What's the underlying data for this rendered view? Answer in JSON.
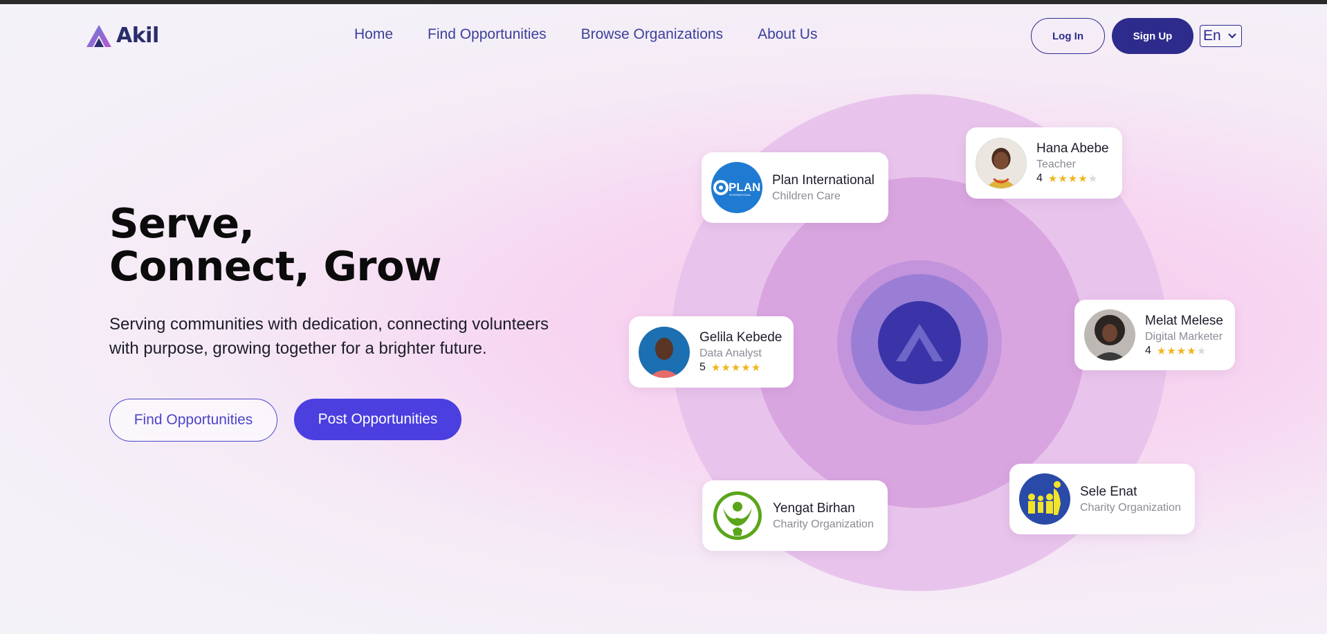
{
  "brand": {
    "name": "Akil",
    "accent": "#2d2b8c",
    "primary_button": "#4b3fe0"
  },
  "nav": {
    "items": [
      {
        "label": "Home"
      },
      {
        "label": "Find Opportunities"
      },
      {
        "label": "Browse Organizations"
      },
      {
        "label": "About Us"
      }
    ]
  },
  "auth": {
    "login_label": "Log In",
    "signup_label": "Sign Up"
  },
  "language": {
    "selected": "En"
  },
  "hero": {
    "title_line1": "Serve,",
    "title_line2": "Connect, Grow",
    "subtitle": "Serving communities with dedication, connecting volunteers with purpose, growing together for a brighter future.",
    "find_button": "Find Opportunities",
    "post_button": "Post Opportunities"
  },
  "orbit_cards": {
    "plan": {
      "name": "Plan International",
      "subtitle": "Children Care",
      "logo_icon": "plan-international-logo",
      "logo_text": "PLAN",
      "logo_subtext": "INTERNATIONAL"
    },
    "hana": {
      "name": "Hana Abebe",
      "subtitle": "Teacher",
      "rating": "4",
      "stars": 4,
      "avatar_icon": "person-avatar"
    },
    "gelila": {
      "name": "Gelila Kebede",
      "subtitle": "Data Analyst",
      "rating": "5",
      "stars": 5,
      "avatar_icon": "person-avatar"
    },
    "melat": {
      "name": "Melat Melese",
      "subtitle": "Digital Marketer",
      "rating": "4",
      "stars": 4,
      "avatar_icon": "person-avatar"
    },
    "yengat": {
      "name": "Yengat Birhan",
      "subtitle": "Charity Organization",
      "logo_icon": "yengat-birhan-logo"
    },
    "sele": {
      "name": "Sele Enat",
      "subtitle": "Charity Organization",
      "logo_icon": "sele-enat-logo"
    }
  }
}
